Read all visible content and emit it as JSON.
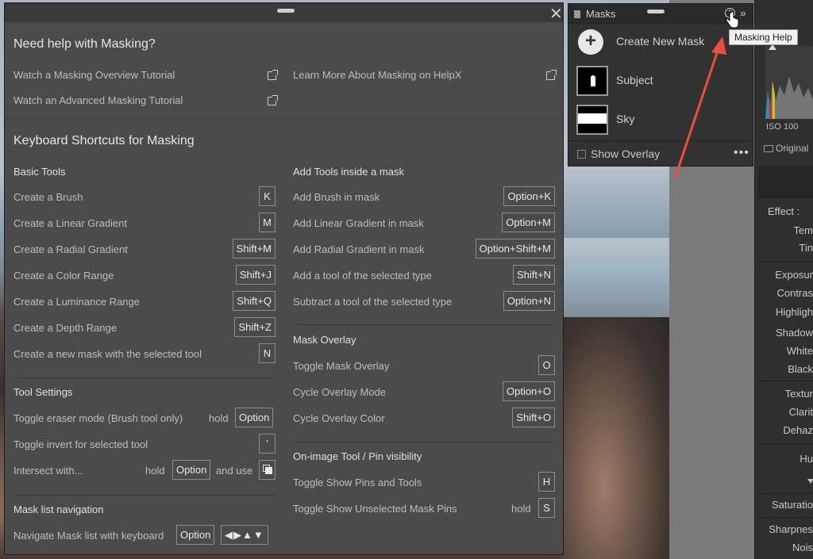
{
  "masks_panel": {
    "title": "Masks",
    "create_new": "Create New Mask",
    "items": [
      {
        "label": "Subject"
      },
      {
        "label": "Sky"
      }
    ],
    "show_overlay": "Show Overlay",
    "more": "•••",
    "tooltip": "Masking Help"
  },
  "right_panel": {
    "iso": "ISO 100",
    "original": "Original",
    "effect": "Effect :",
    "sliders": [
      "Tem",
      "Tin",
      "Exposur",
      "Contras",
      "Highligh",
      "Shadow",
      "White",
      "Black",
      "Textur",
      "Clarit",
      "Dehaz",
      "Hu",
      "Saturatio",
      "Sharpnes",
      "Nois"
    ]
  },
  "help": {
    "title": "Need help with Masking?",
    "links": [
      {
        "label": "Watch a Masking Overview Tutorial"
      },
      {
        "label": "Watch an Advanced Masking Tutorial"
      },
      {
        "label": "Learn More About Masking on HelpX"
      }
    ],
    "shortcuts_title": "Keyboard Shortcuts for Masking",
    "basic_tools": {
      "heading": "Basic Tools",
      "rows": [
        {
          "label": "Create a Brush",
          "key": "K"
        },
        {
          "label": "Create a Linear Gradient",
          "key": "M"
        },
        {
          "label": "Create a Radial Gradient",
          "key": "Shift+M"
        },
        {
          "label": "Create a Color Range",
          "key": "Shift+J"
        },
        {
          "label": "Create a Luminance Range",
          "key": "Shift+Q"
        },
        {
          "label": "Create a Depth Range",
          "key": "Shift+Z"
        },
        {
          "label": "Create a new mask with the selected tool",
          "key": "N"
        }
      ]
    },
    "tool_settings": {
      "heading": "Tool Settings",
      "rows": [
        {
          "label": "Toggle eraser mode (Brush tool only)",
          "pre": "hold",
          "key": "Option"
        },
        {
          "label": "Toggle invert for selected tool",
          "key": "'"
        },
        {
          "label": "Intersect with...",
          "pre": "hold",
          "key": "Option",
          "post": "and use"
        }
      ]
    },
    "mask_list": {
      "heading": "Mask list navigation",
      "rows": [
        {
          "label": "Navigate Mask list with keyboard",
          "key": "Option",
          "key2": "◀▶▲▼"
        }
      ]
    },
    "add_tools": {
      "heading": "Add Tools inside a mask",
      "rows": [
        {
          "label": "Add Brush in mask",
          "key": "Option+K"
        },
        {
          "label": "Add Linear Gradient in mask",
          "key": "Option+M"
        },
        {
          "label": "Add Radial Gradient in mask",
          "key": "Option+Shift+M"
        },
        {
          "label": "Add a tool of the selected type",
          "key": "Shift+N"
        },
        {
          "label": "Subtract a tool of the selected type",
          "key": "Option+N"
        }
      ]
    },
    "mask_overlay": {
      "heading": "Mask Overlay",
      "rows": [
        {
          "label": "Toggle Mask Overlay",
          "key": "O"
        },
        {
          "label": "Cycle Overlay Mode",
          "key": "Option+O"
        },
        {
          "label": "Cycle Overlay Color",
          "key": "Shift+O"
        }
      ]
    },
    "pin_visibility": {
      "heading": "On-image Tool / Pin visibility",
      "rows": [
        {
          "label": "Toggle Show Pins and Tools",
          "key": "H"
        },
        {
          "label": "Toggle Show Unselected Mask Pins",
          "pre": "hold",
          "key": "S"
        }
      ]
    }
  },
  "colors": {
    "dialog_bg": "#4b4b4b",
    "arrow": "#e8503a"
  }
}
